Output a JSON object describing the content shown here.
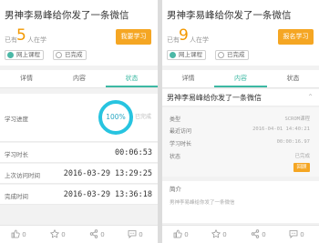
{
  "left": {
    "title": "男神李易峰给你发了一条微信",
    "count_prefix": "已有",
    "count_num": "5",
    "count_suffix": "人在学",
    "start_button": "我要学习",
    "tag_course": "网上课程",
    "tag_done": "已完成",
    "tabs": [
      "详情",
      "内容",
      "状态"
    ],
    "active_tab": "状态",
    "progress_label": "学习进度",
    "progress_value": "100%",
    "progress_done": "已完成",
    "progress_fraction": 1.0,
    "rows": [
      {
        "label": "学习时长",
        "value": "00:06:53"
      },
      {
        "label": "上次访问时间",
        "value": "2016-03-29 13:29:25"
      },
      {
        "label": "完成时间",
        "value": "2016-03-29 13:36:18"
      }
    ]
  },
  "right": {
    "title": "男神李易峰给你发了一条微信",
    "count_prefix": "已有",
    "count_num": "9",
    "count_suffix": "人在学",
    "start_button": "报名学习",
    "tag_course": "网上课程",
    "tag_done": "已完成",
    "tabs": [
      "详情",
      "内容",
      "状态"
    ],
    "active_tab": "内容",
    "section_title": "男神李易峰给你发了一条微信",
    "info": [
      {
        "label": "类型",
        "value": "SCROM课程"
      },
      {
        "label": "最近访问",
        "value": "2016-04-01 14:40:21"
      },
      {
        "label": "学习时长",
        "value": "00:00:16.97"
      },
      {
        "label": "状态",
        "value": "已完成"
      }
    ],
    "mini_button": "回顾",
    "intro_label": "简介",
    "intro_text": "男神李易峰给你发了一条微信"
  },
  "footer": {
    "items": [
      {
        "icon": "thumb-up-icon",
        "count": "0"
      },
      {
        "icon": "star-icon",
        "count": "0"
      },
      {
        "icon": "share-icon",
        "count": "0"
      },
      {
        "icon": "comment-icon",
        "count": "0"
      }
    ]
  },
  "colors": {
    "accent_teal": "#3cb9a3",
    "accent_orange": "#f5a623",
    "progress_blue": "#27c4e0"
  }
}
